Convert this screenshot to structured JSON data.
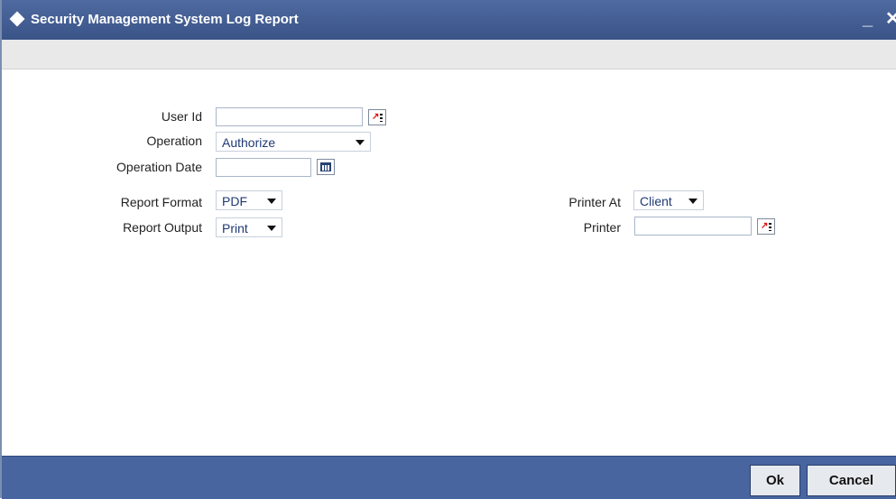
{
  "window": {
    "title": "Security Management System Log Report",
    "minimize_label": "_",
    "close_label": "✕"
  },
  "form": {
    "user_id_label": "User Id",
    "user_id_value": "",
    "operation_label": "Operation",
    "operation_value": "Authorize",
    "operation_date_label": "Operation Date",
    "operation_date_value": "",
    "report_format_label": "Report Format",
    "report_format_value": "PDF",
    "report_output_label": "Report Output",
    "report_output_value": "Print",
    "printer_at_label": "Printer At",
    "printer_at_value": "Client",
    "printer_label": "Printer",
    "printer_value": ""
  },
  "footer": {
    "ok_label": "Ok",
    "cancel_label": "Cancel"
  },
  "colors": {
    "titlebar": "#3a5488",
    "footer": "#4865a0",
    "select_text": "#1f3a74"
  }
}
